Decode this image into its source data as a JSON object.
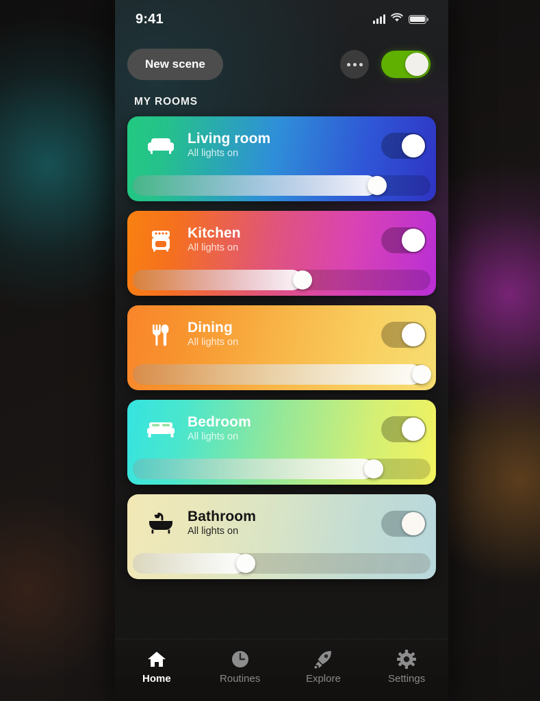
{
  "statusbar": {
    "time": "9:41",
    "signal_icon": "signal-bars-icon",
    "wifi_icon": "wifi-icon",
    "battery_icon": "battery-icon"
  },
  "header": {
    "new_scene_label": "New scene",
    "more_icon": "more-options-icon",
    "master_toggle_state": "on",
    "master_toggle_color": "#5fb000"
  },
  "section": {
    "title": "MY ROOMS"
  },
  "rooms": [
    {
      "name": "Living room",
      "status": "All lights on",
      "icon": "sofa-icon",
      "toggle_state": "on",
      "brightness": 82,
      "gradient_from": "#22c97f",
      "gradient_to": "#2f34c4",
      "text_theme": "light"
    },
    {
      "name": "Kitchen",
      "status": "All lights on",
      "icon": "stove-icon",
      "toggle_state": "on",
      "brightness": 57,
      "gradient_from": "#f98211",
      "gradient_to": "#b92ed6",
      "text_theme": "light"
    },
    {
      "name": "Dining",
      "status": "All lights on",
      "icon": "cutlery-icon",
      "toggle_state": "on",
      "brightness": 97,
      "gradient_from": "#f9852a",
      "gradient_to": "#f6dd72",
      "text_theme": "light"
    },
    {
      "name": "Bedroom",
      "status": "All lights on",
      "icon": "bed-icon",
      "toggle_state": "on",
      "brightness": 81,
      "gradient_from": "#35e4e0",
      "gradient_to": "#f3f25f",
      "text_theme": "light"
    },
    {
      "name": "Bathroom",
      "status": "All lights on",
      "icon": "bathtub-icon",
      "toggle_state": "on",
      "brightness": 38,
      "gradient_from": "#f2e8b6",
      "gradient_to": "#b8d8dc",
      "text_theme": "dark"
    }
  ],
  "tabbar": [
    {
      "label": "Home",
      "icon": "home-icon",
      "active": true
    },
    {
      "label": "Routines",
      "icon": "clock-icon",
      "active": false
    },
    {
      "label": "Explore",
      "icon": "rocket-icon",
      "active": false
    },
    {
      "label": "Settings",
      "icon": "gear-icon",
      "active": false
    }
  ]
}
